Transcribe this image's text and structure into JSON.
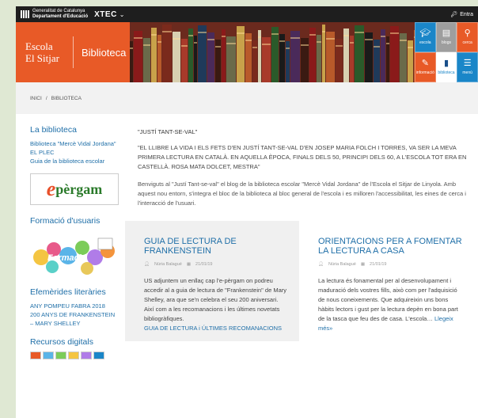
{
  "topbar": {
    "gencat_line1": "Generalitat de Catalunya",
    "gencat_line2": "Departament d'Educació",
    "xtec": "XTEC",
    "login": "Entra"
  },
  "brand": {
    "school_line1": "Escola",
    "school_line2": "El Sitjar",
    "section": "Biblioteca",
    "color": "#e85a27"
  },
  "tiles": [
    {
      "label": "escola",
      "icon": "graduation-cap-icon",
      "color": "#1a86c8"
    },
    {
      "label": "blogs",
      "icon": "blog-icon",
      "color": "#9e9e9e"
    },
    {
      "label": "cerca",
      "icon": "search-icon",
      "color": "#e85a27"
    },
    {
      "label": "informació",
      "icon": "info-icon",
      "color": "#e85a27"
    },
    {
      "label": "biblioteca",
      "icon": "book-icon",
      "color": "#ffffff"
    },
    {
      "label": "menú",
      "icon": "menu-icon",
      "color": "#1a86c8"
    }
  ],
  "breadcrumb": {
    "home": "INICI",
    "sep": "/",
    "current": "BIBLIOTECA"
  },
  "sidebar": {
    "section1_title": "La biblioteca",
    "links1": [
      "Biblioteca \"Mercè Vidal Jordana\"",
      "EL PLEC",
      "Guia de la biblioteca escolar"
    ],
    "epergam_e": "e",
    "epergam_rest": "pèrgam",
    "section2_title": "Formació d'usuaris",
    "formacio_label": "Formació",
    "section3_title": "Efemèrides literàries",
    "links3": [
      "ANY POMPEU FABRA 2018",
      "200 ANYS DE FRANKENSTEIN – MARY SHELLEY"
    ],
    "section4_title": "Recursos digitals"
  },
  "main": {
    "post_title": "\"JUSTÍ TANT-SE-VAL\"",
    "quote": "\"EL LLIBRE LA VIDA I ELS FETS D'EN JUSTÍ TANT-SE-VAL D'EN JOSEP MARIA FOLCH I TORRES, VA SER LA MEVA PRIMERA LECTURA EN CATALÀ. EN AQUELLA ÈPOCA, FINALS DELS 50, PRINCIPI DELS 60, A L'ESCOLA TOT ERA EN CASTELLÀ. ROSA MATA DOLCET, MESTRA\"",
    "body": "Benviguts al \"Justí Tant-se-val\" el blog de la biblioteca escolar \"Mercè Vidal Jordana\" de l'Escola el Sitjar de Linyola. Amb aquest nou entorn, s'integra el bloc de la biblioteca al bloc general de l'escola i es milloren l'accessibilitat, les eines de cerca i l'interacció de l'usuari."
  },
  "cards": [
    {
      "title": "GUIA DE LECTURA DE FRANKENSTEIN",
      "author": "Núria Balagué",
      "date": "21/01/19",
      "text": "US adjuntem un enllaç cap l'e-pèrgam on podreu accedir al a guia de lectura de \"Frankenstein\" de Mary Shelley, ara que se'n celebra el seu 200 aniversari. Així com a les recomanacions i les últimes novetats bibliogràfiques.",
      "link": "GUIA DE LECTURA i ÚLTIMES RECOMANACIONS"
    },
    {
      "title": "ORIENTACIONS PER A FOMENTAR LA LECTURA A CASA",
      "author": "Núria Balagué",
      "date": "21/01/19",
      "text": "La lectura és fonamental per al desenvolupament i maduració dels vostres fills, això com per l'adquisició de nous coneixements. Que adquireixin uns bons hàbits lectors i gust per la lectura depèn en bona part de la tasca que feu des de casa. L'escola…",
      "link": "Llegeix més»"
    }
  ],
  "colors": {
    "link": "#1f6fa8",
    "topbar": "#1e1e1e",
    "background": "#dfe8d3"
  }
}
